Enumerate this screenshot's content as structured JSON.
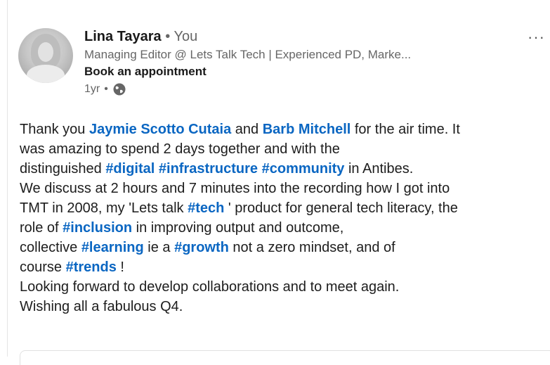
{
  "author": {
    "name": "Lina Tayara",
    "separator": "•",
    "relation": "You",
    "headline": "Managing Editor @ Lets Talk Tech | Experienced PD, Marke...",
    "cta": "Book an appointment",
    "time": "1yr",
    "time_separator": "•"
  },
  "menu": {
    "more_label": "···"
  },
  "post": {
    "l1_a": "Thank you ",
    "mention_1": "Jaymie Scotto Cutaia",
    "l1_b": " and ",
    "mention_2": "Barb Mitchell",
    "l1_c": " for the air time. It",
    "l2": "was amazing to spend 2 days together and with the",
    "l3_a": "distinguished ",
    "tag_digital": "#digital",
    "tag_infrastructure": "#infrastructure",
    "tag_community": "#community",
    "l3_b": " in Antibes.",
    "l4": "We discuss at 2 hours and 7 minutes into the recording how I got into",
    "l5_a": "TMT in 2008, my 'Lets talk ",
    "tag_tech": "#tech",
    "l5_b": " ' product for general tech literacy, the",
    "l6_a": "role of ",
    "tag_inclusion": "#inclusion",
    "l6_b": " in improving output and outcome,",
    "l7_a": "collective ",
    "tag_learning": "#learning",
    "l7_b": " ie a ",
    "tag_growth": "#growth",
    "l7_c": " not a zero mindset, and of",
    "l8_a": "course ",
    "tag_trends": "#trends",
    "l8_b": " !",
    "l9": "Looking forward to develop collaborations and to meet again.",
    "l10": "Wishing all a fabulous Q4."
  },
  "colors": {
    "link": "#0a66c2",
    "muted": "#666666",
    "text": "#1d1d1d"
  }
}
